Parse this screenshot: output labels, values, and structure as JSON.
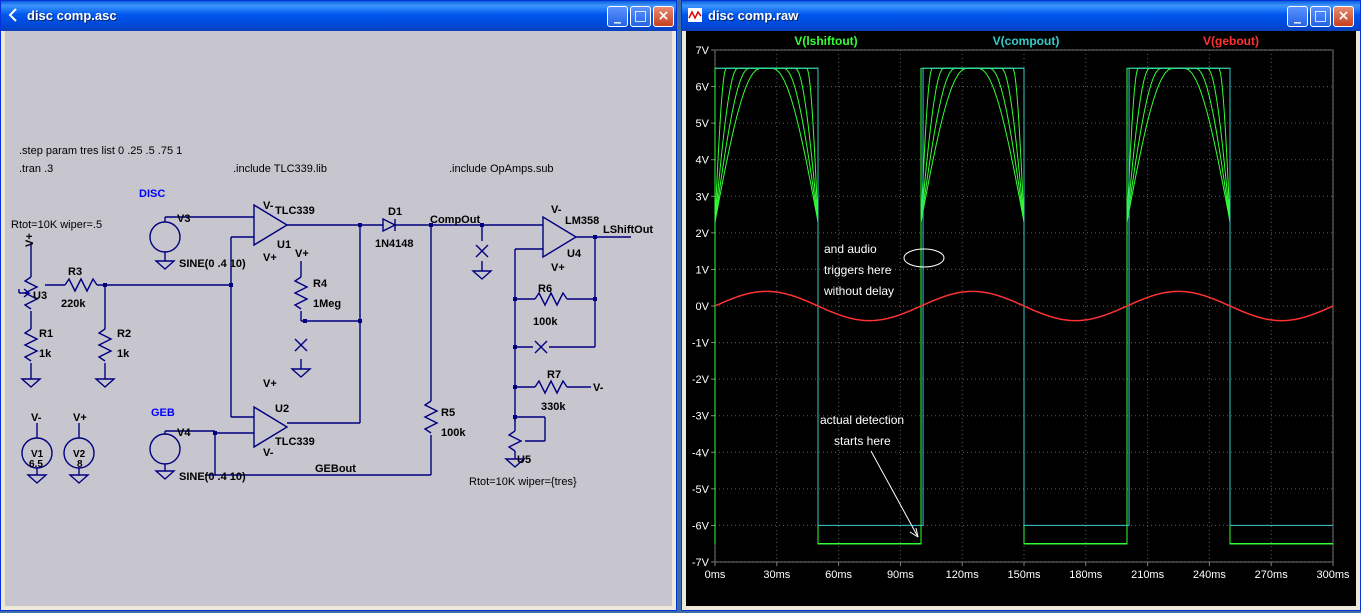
{
  "schematic_window": {
    "title": "disc comp.asc",
    "directives": {
      "step": ".step param tres list 0 .25 .5 .75 1",
      "tran": ".tran .3",
      "include_tlc": ".include TLC339.lib",
      "include_opamps": ".include OpAmps.sub"
    },
    "labels": {
      "disc": "DISC",
      "geb": "GEB",
      "rtot1": "Rtot=10K wiper=.5",
      "rtot2": "Rtot=10K wiper={tres}",
      "compout": "CompOut",
      "lshiftout": "LShiftOut",
      "gebout": "GEBout"
    },
    "components": {
      "r1": "R1",
      "r1_val": "1k",
      "r2": "R2",
      "r2_val": "1k",
      "r3": "R3",
      "r3_val": "220k",
      "r4": "R4",
      "r4_val": "1Meg",
      "r5": "R5",
      "r5_val": "100k",
      "r6": "R6",
      "r6_val": "100k",
      "r7": "R7",
      "r7_val": "330k",
      "u1": "U1",
      "u1_model": "TLC339",
      "u2": "U2",
      "u2_model": "TLC339",
      "u3": "U3",
      "u4": "U4",
      "u4_model": "LM358",
      "u5": "U5",
      "v1": "V1",
      "v1_val": "6.5",
      "v2": "V2",
      "v2_val": "8",
      "v3": "V3",
      "v3_val": "SINE(0 .4 10)",
      "v4": "V4",
      "v4_val": "SINE(0 .4 10)",
      "d1": "D1",
      "d1_model": "1N4148",
      "vplus": "V+",
      "vminus": "V-"
    }
  },
  "waveform_window": {
    "title": "disc comp.raw",
    "traces": [
      {
        "name": "V(lshiftout)",
        "color": "#33ff33"
      },
      {
        "name": "V(compout)",
        "color": "#33cccc"
      },
      {
        "name": "V(gebout)",
        "color": "#ff3333"
      }
    ],
    "annotations": {
      "a1": "and audio",
      "a2": "triggers here",
      "a3": "without delay",
      "b1": "actual detection",
      "b2": "starts here"
    },
    "y_ticks": [
      "7V",
      "6V",
      "5V",
      "4V",
      "3V",
      "2V",
      "1V",
      "0V",
      "-1V",
      "-2V",
      "-3V",
      "-4V",
      "-5V",
      "-6V",
      "-7V"
    ],
    "x_ticks": [
      "0ms",
      "30ms",
      "60ms",
      "90ms",
      "120ms",
      "150ms",
      "180ms",
      "210ms",
      "240ms",
      "270ms",
      "300ms"
    ]
  },
  "chart_data": {
    "type": "line",
    "xlabel": "",
    "ylabel": "",
    "xlim": [
      0,
      300
    ],
    "ylim": [
      -7,
      7
    ],
    "x_unit": "ms",
    "y_unit": "V",
    "grid": true,
    "series": [
      {
        "name": "V(lshiftout)",
        "color": "#33ff33",
        "description_values": "square-ish pulses high 6.5 between approx 0-50, 100-150, 200-250 ms; low -6.5 otherwise; stepped rise variants",
        "x": [
          0,
          50,
          50,
          100,
          100,
          150,
          150,
          200,
          200,
          250,
          250,
          300
        ],
        "y": [
          6.5,
          6.5,
          -6.5,
          -6.5,
          6.5,
          6.5,
          -6.5,
          -6.5,
          6.5,
          6.5,
          -6.5,
          -6.5
        ]
      },
      {
        "name": "V(compout)",
        "color": "#33cccc",
        "x": [
          0,
          50,
          50,
          101,
          101,
          150,
          150,
          201,
          201,
          250,
          250,
          300
        ],
        "y": [
          6.5,
          6.5,
          -6.0,
          -6.0,
          6.5,
          6.5,
          -6.0,
          -6.0,
          6.5,
          6.5,
          -6.0,
          -6.0
        ]
      },
      {
        "name": "V(gebout)",
        "color": "#ff3333",
        "x": [
          0,
          25,
          50,
          75,
          100,
          125,
          150,
          175,
          200,
          225,
          250,
          275,
          300
        ],
        "y": [
          0,
          0.4,
          0,
          -0.4,
          0,
          0.4,
          0,
          -0.4,
          0,
          0.4,
          0,
          -0.4,
          0
        ]
      }
    ]
  }
}
